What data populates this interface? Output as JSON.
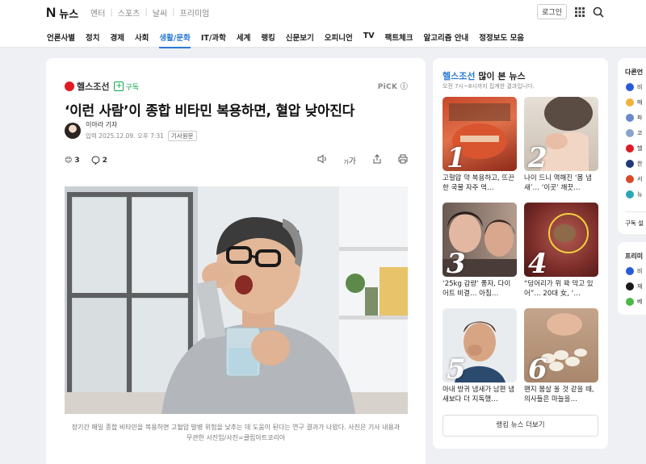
{
  "header": {
    "logo_n": "N",
    "logo_text": "뉴스",
    "services": [
      "엔터",
      "스포츠",
      "날씨",
      "프리미엄"
    ],
    "login_label": "로그인"
  },
  "nav": [
    "언론사별",
    "정치",
    "경제",
    "사회",
    "생활/문화",
    "IT/과학",
    "세계",
    "랭킹",
    "신문보기",
    "오피니언",
    "TV",
    "팩트체크",
    "알고리즘 안내",
    "정정보도 모음"
  ],
  "article": {
    "press_name": "헬스조선",
    "subscribe_label": "구독",
    "pick_label": "PiCK",
    "title": "‘이런 사람’이 종합 비타민 복용하면, 혈압 낮아진다",
    "reporter": "이아라 기자",
    "date": "입력 2025.12.09. 오후 7:31",
    "original_label": "기사원문",
    "reaction_count": "3",
    "comment_count": "2",
    "text_size_label": "가",
    "caption": "장기간 매일 종합 비타민을 복용하면 고혈압 발병 위험을 낮추는 데 도움이 된다는 연구 결과가 나왔다. 사진은 기사 내용과 무관한 사진임/사진=클립아트코리아"
  },
  "ranking": {
    "brand": "헬스조선",
    "title_suffix": " 많이 본 뉴스",
    "subtitle": "오전 7시~8시까지 집계한 결과입니다.",
    "items": [
      {
        "num": "1",
        "caption": "고혈압 약 복용하고, 뜨끈한 국물 자주 먹…"
      },
      {
        "num": "2",
        "caption": "나이 드니 역해진 ‘몸 냄새’… ‘이곳’ 깨끗…"
      },
      {
        "num": "3",
        "caption": "‘25kg 감량’ 풍자, 다이어트 비결… 아침…"
      },
      {
        "num": "4",
        "caption": "“덩어리가 위 꽉 막고 있어”… 20대 女, ‘…"
      },
      {
        "num": "5",
        "caption": "아내 방귀 냄새가 남편 냄새보다 더 지독했…"
      },
      {
        "num": "6",
        "caption": "왠지 몸살 올 것 같을 때, 의사들은 마늘을…"
      }
    ],
    "more_label": "랭킹 뉴스 더보기"
  },
  "side": {
    "header": "다른언",
    "items": [
      "비",
      "매",
      "파",
      "코",
      "헬",
      "한",
      "서",
      "뉴"
    ],
    "footer": "구독 설",
    "header2": "프리미",
    "items2": [
      "비",
      "재",
      "베"
    ]
  },
  "colors": {
    "accent": "#2a7ad6",
    "subscribe": "#11a84e",
    "press_red": "#e01b22"
  }
}
